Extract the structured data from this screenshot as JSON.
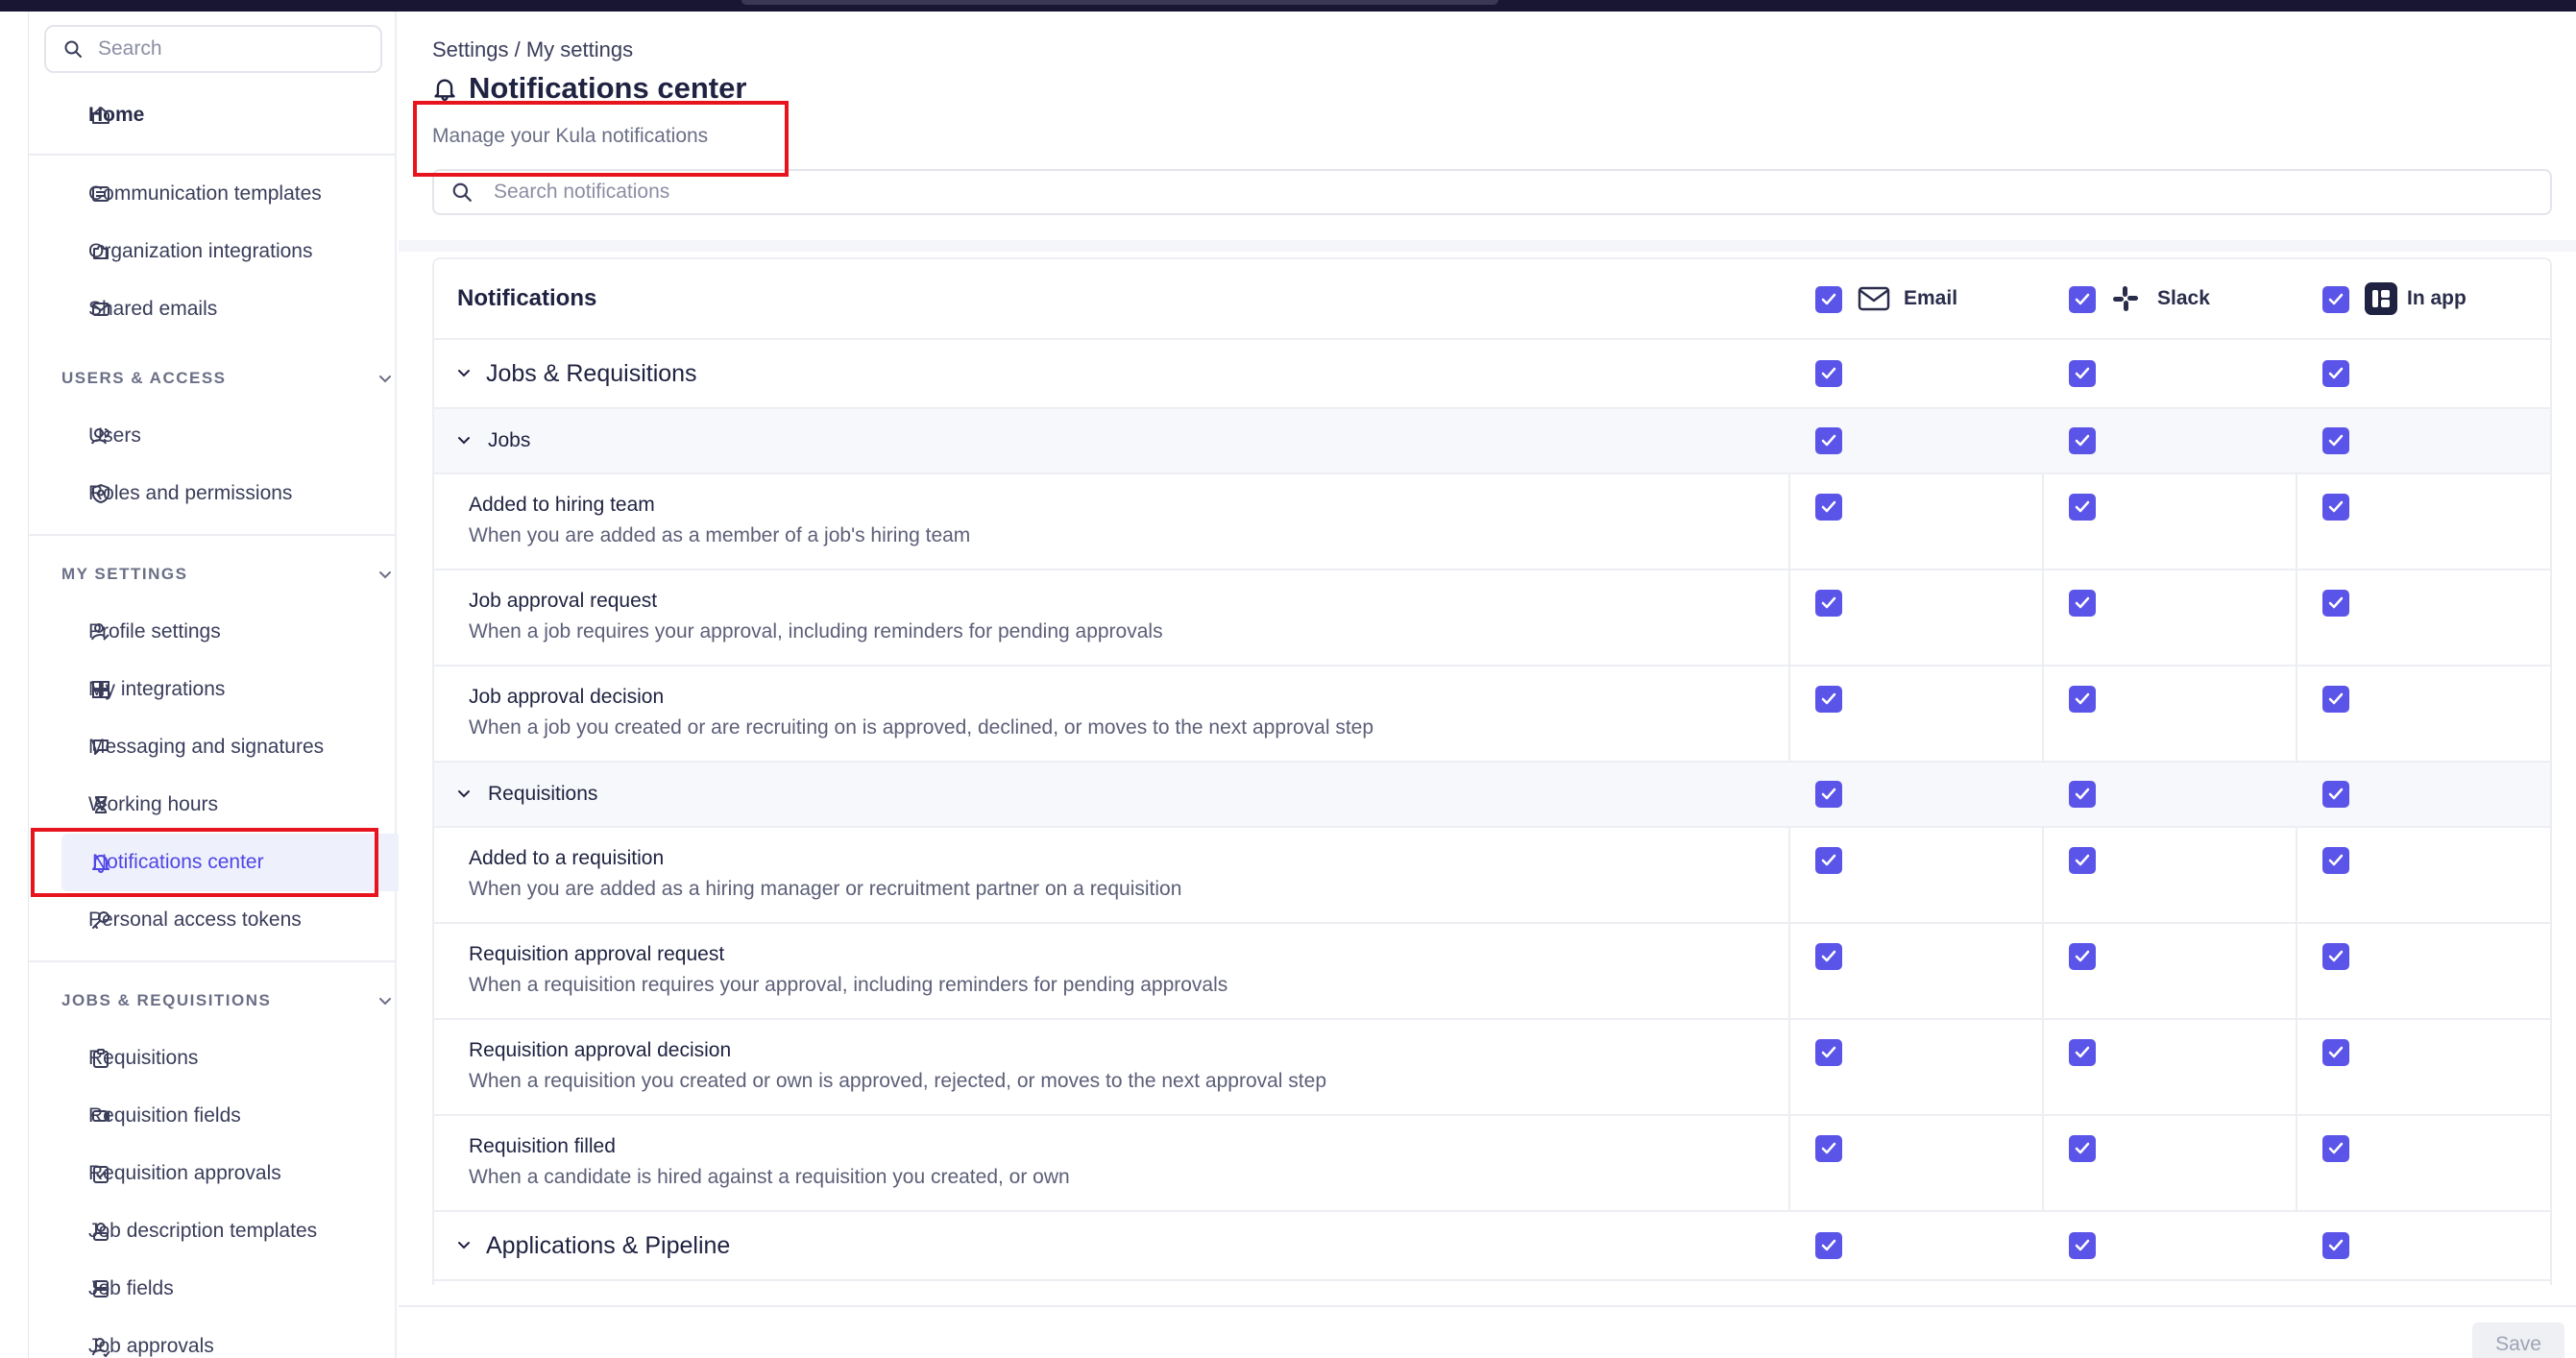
{
  "sidebar": {
    "search_placeholder": "Search",
    "home": "Home",
    "items_top": [
      "Communication templates",
      "Organization integrations",
      "Shared emails"
    ],
    "section_users": "USERS & ACCESS",
    "items_users": [
      "Users",
      "Roles and permissions"
    ],
    "section_my": "MY SETTINGS",
    "items_my": [
      "Profile settings",
      "My integrations",
      "Messaging and signatures",
      "Working hours",
      "Notifications center",
      "Personal access tokens"
    ],
    "section_jobs": "JOBS & REQUISITIONS",
    "items_jobs": [
      "Requisitions",
      "Requisition fields",
      "Requisition approvals",
      "Job description templates",
      "Job fields",
      "Job approvals"
    ],
    "active_item": "Notifications center"
  },
  "header": {
    "breadcrumb": "Settings / My settings",
    "title": "Notifications center",
    "subtitle": "Manage your Kula notifications",
    "search_placeholder": "Search notifications"
  },
  "table": {
    "title": "Notifications",
    "channels": [
      "Email",
      "Slack",
      "In app"
    ],
    "groups": {
      "jobs_requisitions": "Jobs & Requisitions",
      "jobs": "Jobs",
      "requisitions": "Requisitions",
      "applications_pipeline": "Applications & Pipeline"
    },
    "rows": [
      {
        "title": "Added to hiring team",
        "desc": "When you are added as a member of a job's hiring team"
      },
      {
        "title": "Job approval request",
        "desc": "When a job requires your approval, including reminders for pending approvals"
      },
      {
        "title": "Job approval decision",
        "desc": "When a job you created or are recruiting on is approved, declined, or moves to the next approval step"
      },
      {
        "title": "Added to a requisition",
        "desc": "When you are added as a hiring manager or recruitment partner on a requisition"
      },
      {
        "title": "Requisition approval request",
        "desc": "When a requisition requires your approval, including reminders for pending approvals"
      },
      {
        "title": "Requisition approval decision",
        "desc": "When a requisition you created or own is approved, rejected, or moves to the next approval step"
      },
      {
        "title": "Requisition filled",
        "desc": "When a candidate is hired against a requisition you created, or own"
      }
    ],
    "all_checked": true
  },
  "footer": {
    "save_label": "Save"
  },
  "colors": {
    "accent": "#5b54e8",
    "highlight_box": "#e8141d",
    "topbar": "#181633"
  }
}
